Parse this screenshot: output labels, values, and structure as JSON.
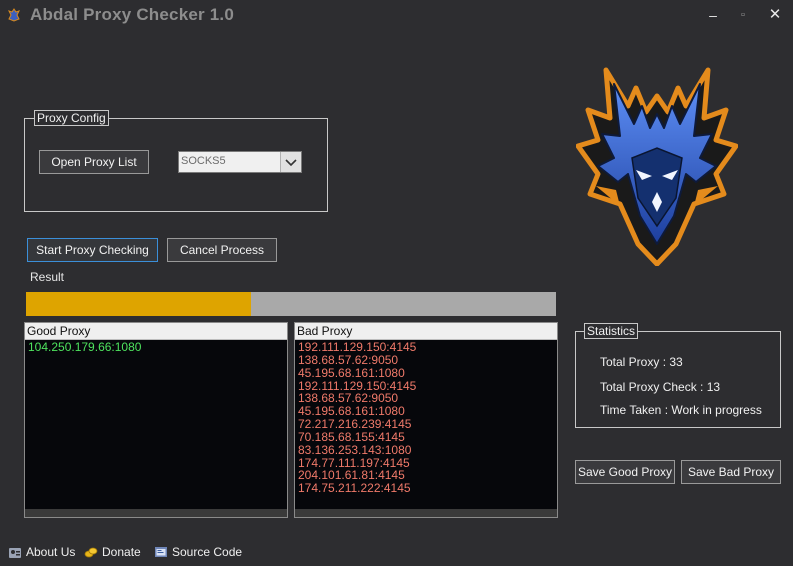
{
  "window": {
    "title": "Abdal Proxy Checker 1.0",
    "controls": {
      "minimize": "–",
      "maximize": "▫",
      "close": "✕"
    }
  },
  "proxy_config": {
    "legend": "Proxy Config",
    "open_button": "Open Proxy List",
    "protocol_selected": "SOCKS5"
  },
  "actions": {
    "start": "Start Proxy Checking",
    "cancel": "Cancel Process"
  },
  "result": {
    "label": "Result",
    "progress_fraction": 0.424,
    "progress_color": "#dea400"
  },
  "good_proxy": {
    "header": "Good Proxy",
    "items": [
      "104.250.179.66:1080"
    ]
  },
  "bad_proxy": {
    "header": "Bad Proxy",
    "items": [
      "192.111.129.150:4145",
      "138.68.57.62:9050",
      "45.195.68.161:1080",
      "192.111.129.150:4145",
      "138.68.57.62:9050",
      "45.195.68.161:1080",
      "72.217.216.239:4145",
      "70.185.68.155:4145",
      "83.136.253.143:1080",
      "174.77.111.197:4145",
      "204.101.61.81:4145",
      "174.75.211.222:4145"
    ]
  },
  "statistics": {
    "legend": "Statistics",
    "total_proxy": "Total Proxy : 33",
    "total_check": "Total Proxy Check : 13",
    "time_taken": "Time Taken : Work in progress"
  },
  "save": {
    "good": "Save Good Proxy",
    "bad": "Save Bad Proxy"
  },
  "footer": {
    "about": "About Us",
    "donate": "Donate",
    "source": "Source Code"
  },
  "icons": {
    "app": "dragon-app-icon",
    "about": "about-icon",
    "donate": "coins-icon",
    "source": "code-icon",
    "dropdown": "chevron-down-icon"
  },
  "colors": {
    "background": "#2d2d30",
    "good": "#4ee35e",
    "bad": "#f07a6a",
    "accent": "#3b8fd9"
  }
}
